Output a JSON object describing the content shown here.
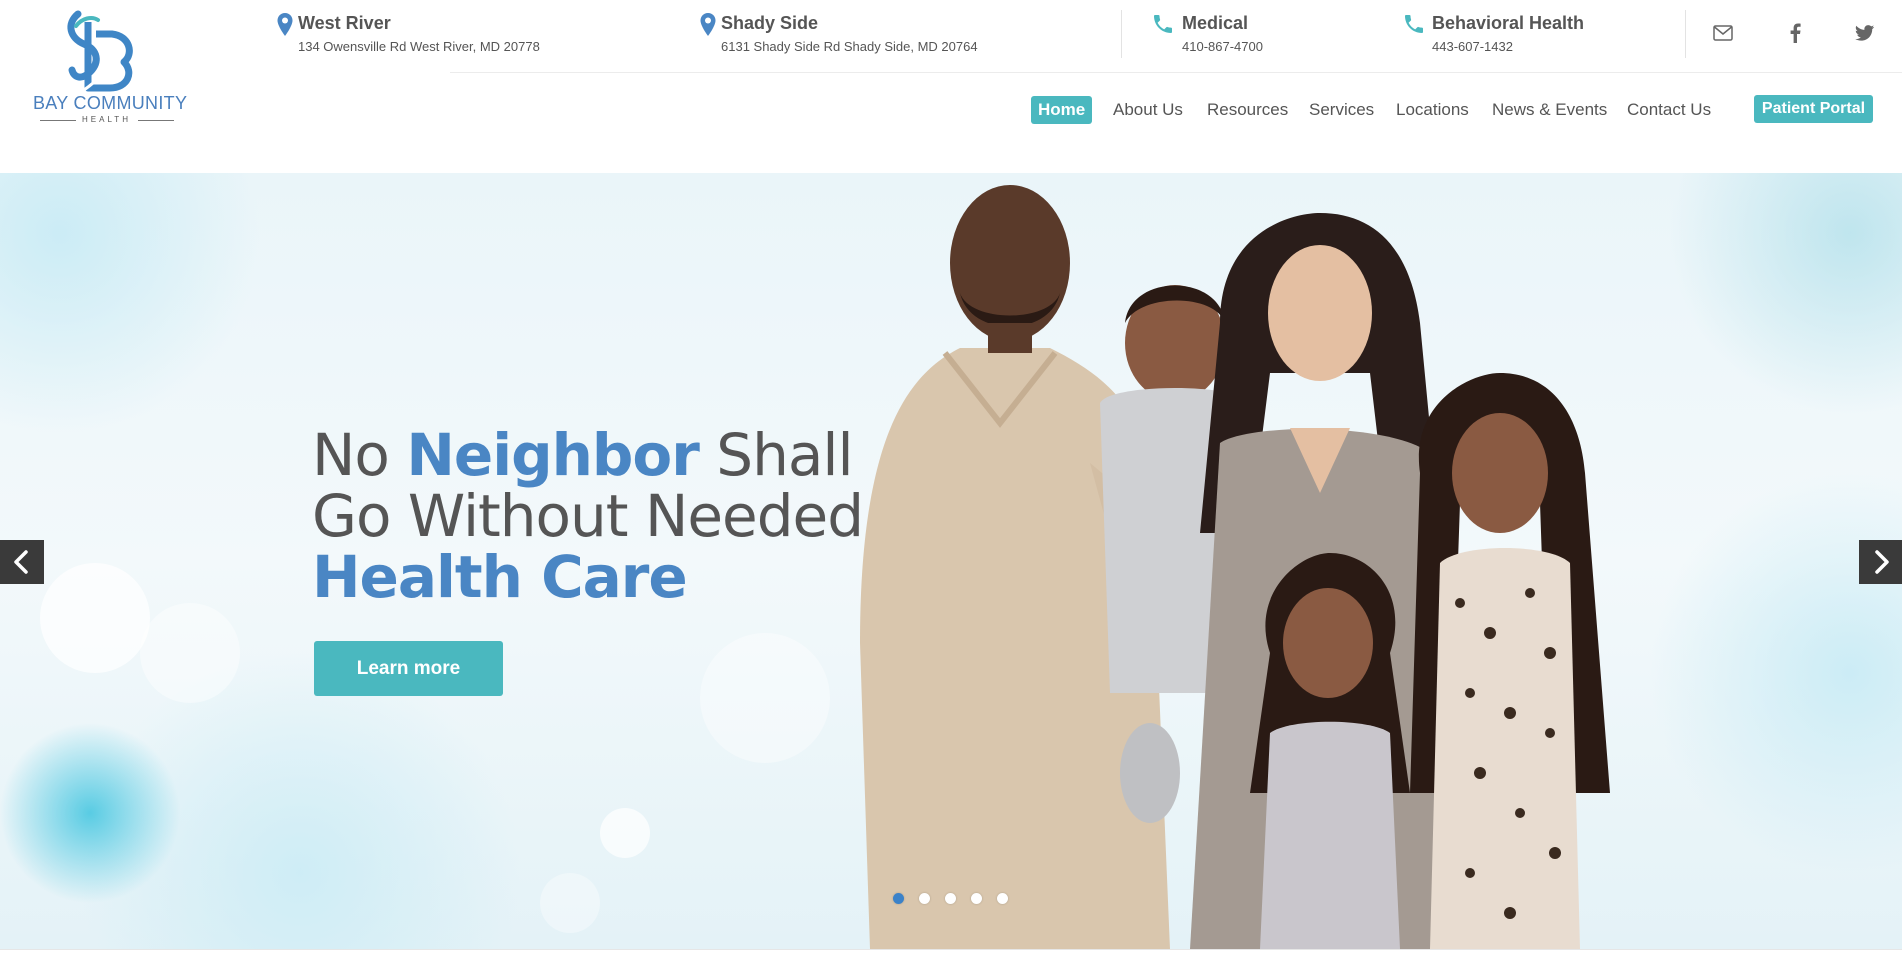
{
  "brand": {
    "name": "BAY COMMUNITY",
    "subname": "HEALTH",
    "accent": "#4ab8bf",
    "blue": "#4a86c4"
  },
  "header": {
    "locations": [
      {
        "title": "West River",
        "address": "134 Owensville Rd West River, MD 20778",
        "icon": "map-pin-icon"
      },
      {
        "title": "Shady Side",
        "address": "6131 Shady Side Rd Shady Side, MD 20764",
        "icon": "map-pin-icon"
      }
    ],
    "phones": [
      {
        "title": "Medical",
        "number": "410-867-4700",
        "icon": "phone-icon"
      },
      {
        "title": "Behavioral Health",
        "number": "443-607-1432",
        "icon": "phone-icon"
      }
    ],
    "social": [
      "envelope-icon",
      "facebook-icon",
      "twitter-icon"
    ]
  },
  "nav": {
    "items": [
      "Home",
      "About Us",
      "Resources",
      "Services",
      "Locations",
      "News & Events",
      "Contact Us"
    ],
    "active": "Home",
    "portal": "Patient Portal"
  },
  "hero": {
    "line1a": "No ",
    "line1b": "Neighbor",
    "line1c": " Shall",
    "line2": "Go Without Needed",
    "line3": "Health Care",
    "button": "Learn more",
    "slides": 5,
    "active_slide": 1
  }
}
